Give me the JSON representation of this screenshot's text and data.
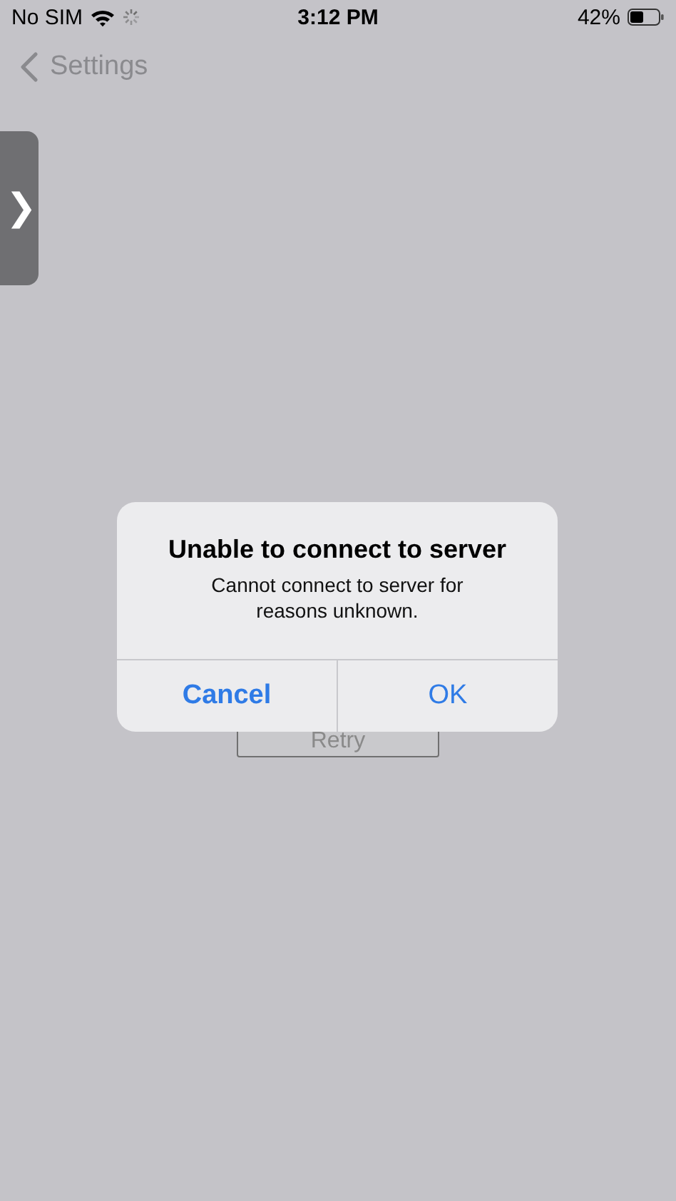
{
  "status_bar": {
    "carrier": "No SIM",
    "time": "3:12 PM",
    "battery": "42%"
  },
  "nav": {
    "back_label": "Settings"
  },
  "side_tab": {
    "glyph": "❯"
  },
  "retry_button": {
    "label": "Retry"
  },
  "alert": {
    "title": "Unable to connect to server",
    "message": "Cannot connect to server for reasons unknown.",
    "buttons": [
      {
        "label": "Cancel",
        "kind": "bold"
      },
      {
        "label": "OK",
        "kind": "normal"
      }
    ]
  }
}
